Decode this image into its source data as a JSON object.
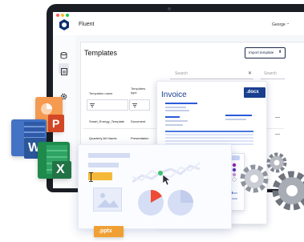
{
  "app": {
    "title": "Fluent",
    "user": "George",
    "user_caret": "⌄"
  },
  "page": {
    "title": "Templates",
    "import_button": "Import template",
    "import_icon": "⬆"
  },
  "search": {
    "placeholder": "Search",
    "clear": "✕",
    "placeholder2": "Search"
  },
  "table": {
    "headers": [
      "Templates name",
      "Templates type"
    ],
    "rows": [
      {
        "name": "Smart_Energy_Template",
        "type": "Document"
      },
      {
        "name": "Quarterly All Hands",
        "type": "Presentation"
      }
    ],
    "row_action": "—"
  },
  "invoice": {
    "title": "Invoice",
    "badge": ".docx"
  },
  "pptx": {
    "badge": ".pptx"
  },
  "word": {
    "letter": "W"
  },
  "powerpoint": {
    "letter": "P"
  },
  "excel": {
    "letter": "X"
  },
  "colors": {
    "accent": "#0f2f6e",
    "badge_blue": "#1a3f8f",
    "pptx_orange": "#f0a033",
    "word_blue": "#2b579a",
    "ppt_orange": "#d24726",
    "excel_green": "#217346",
    "traffic_red": "#ff5f57",
    "traffic_yellow": "#febc2e",
    "traffic_green": "#28c840"
  },
  "icons": [
    "fluent-logo-icon",
    "database-icon",
    "document-icon",
    "gear-icon",
    "filter-icon",
    "cursor-icon"
  ]
}
